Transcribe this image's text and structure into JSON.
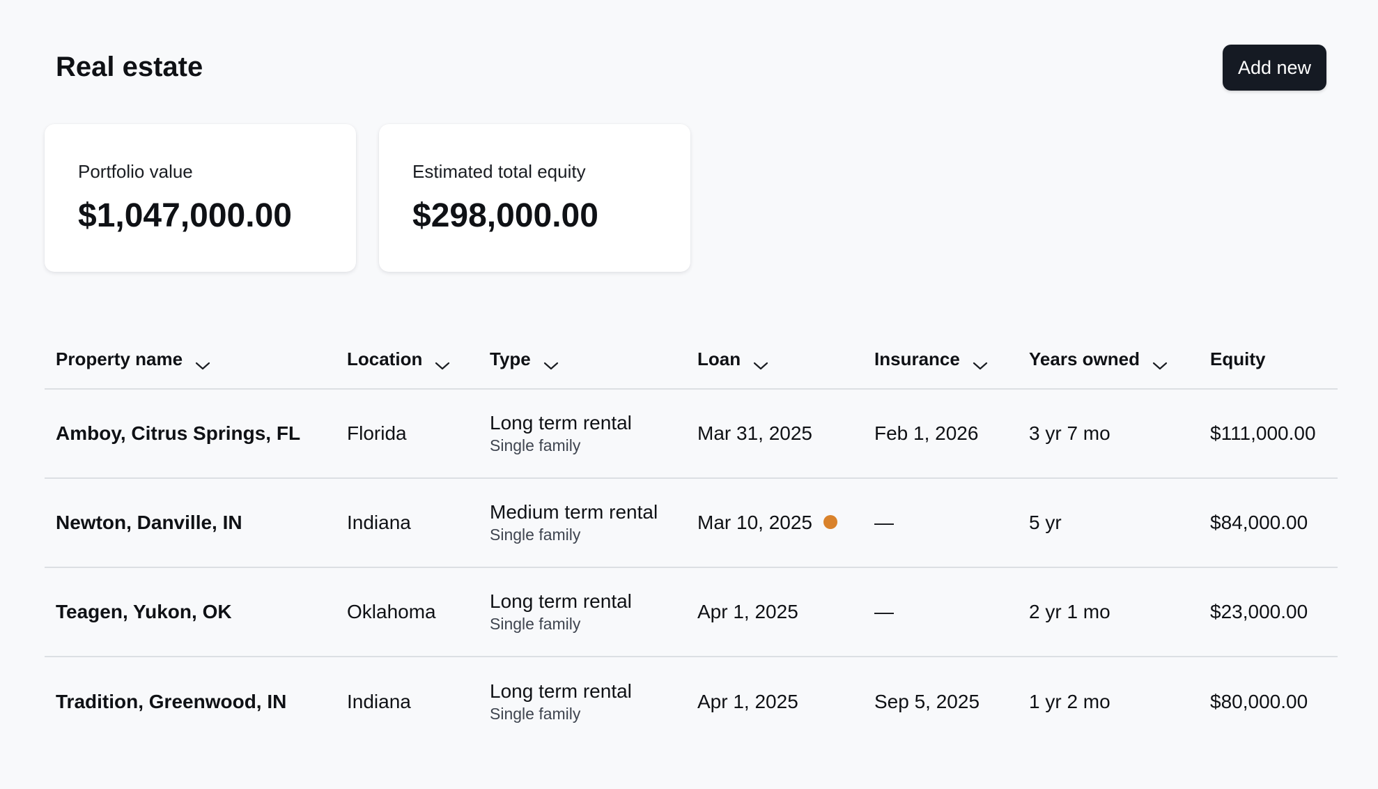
{
  "header": {
    "title": "Real estate",
    "add_button_label": "Add new"
  },
  "summary_cards": [
    {
      "label": "Portfolio value",
      "value": "$1,047,000.00"
    },
    {
      "label": "Estimated total equity",
      "value": "$298,000.00"
    }
  ],
  "table": {
    "columns": [
      {
        "label": "Property name",
        "sortable": true
      },
      {
        "label": "Location",
        "sortable": true
      },
      {
        "label": "Type",
        "sortable": true
      },
      {
        "label": "Loan",
        "sortable": true
      },
      {
        "label": "Insurance",
        "sortable": true
      },
      {
        "label": "Years owned",
        "sortable": true
      },
      {
        "label": "Equity",
        "sortable": false
      }
    ],
    "rows": [
      {
        "name": "Amboy, Citrus Springs, FL",
        "location": "Florida",
        "type": "Long term rental",
        "subtype": "Single family",
        "loan": "Mar 31, 2025",
        "loan_alert": false,
        "insurance": "Feb 1, 2026",
        "years_owned": "3 yr 7 mo",
        "equity": "$111,000.00"
      },
      {
        "name": "Newton, Danville, IN",
        "location": "Indiana",
        "type": "Medium term rental",
        "subtype": "Single family",
        "loan": "Mar 10, 2025",
        "loan_alert": true,
        "insurance": "—",
        "years_owned": "5 yr",
        "equity": "$84,000.00"
      },
      {
        "name": "Teagen, Yukon, OK",
        "location": "Oklahoma",
        "type": "Long term rental",
        "subtype": "Single family",
        "loan": "Apr 1, 2025",
        "loan_alert": false,
        "insurance": "—",
        "years_owned": "2 yr 1 mo",
        "equity": "$23,000.00"
      },
      {
        "name": "Tradition, Greenwood, IN",
        "location": "Indiana",
        "type": "Long term rental",
        "subtype": "Single family",
        "loan": "Apr 1, 2025",
        "loan_alert": false,
        "insurance": "Sep 5, 2025",
        "years_owned": "1 yr 2 mo",
        "equity": "$80,000.00"
      }
    ]
  },
  "icons": {
    "sort": "chevron-down-icon",
    "loan_alert": "status-dot-icon"
  },
  "colors": {
    "button_bg": "#151a23",
    "alert_dot": "#d9822b",
    "divider": "#dcdfe3",
    "page_bg": "#f8f9fb"
  }
}
